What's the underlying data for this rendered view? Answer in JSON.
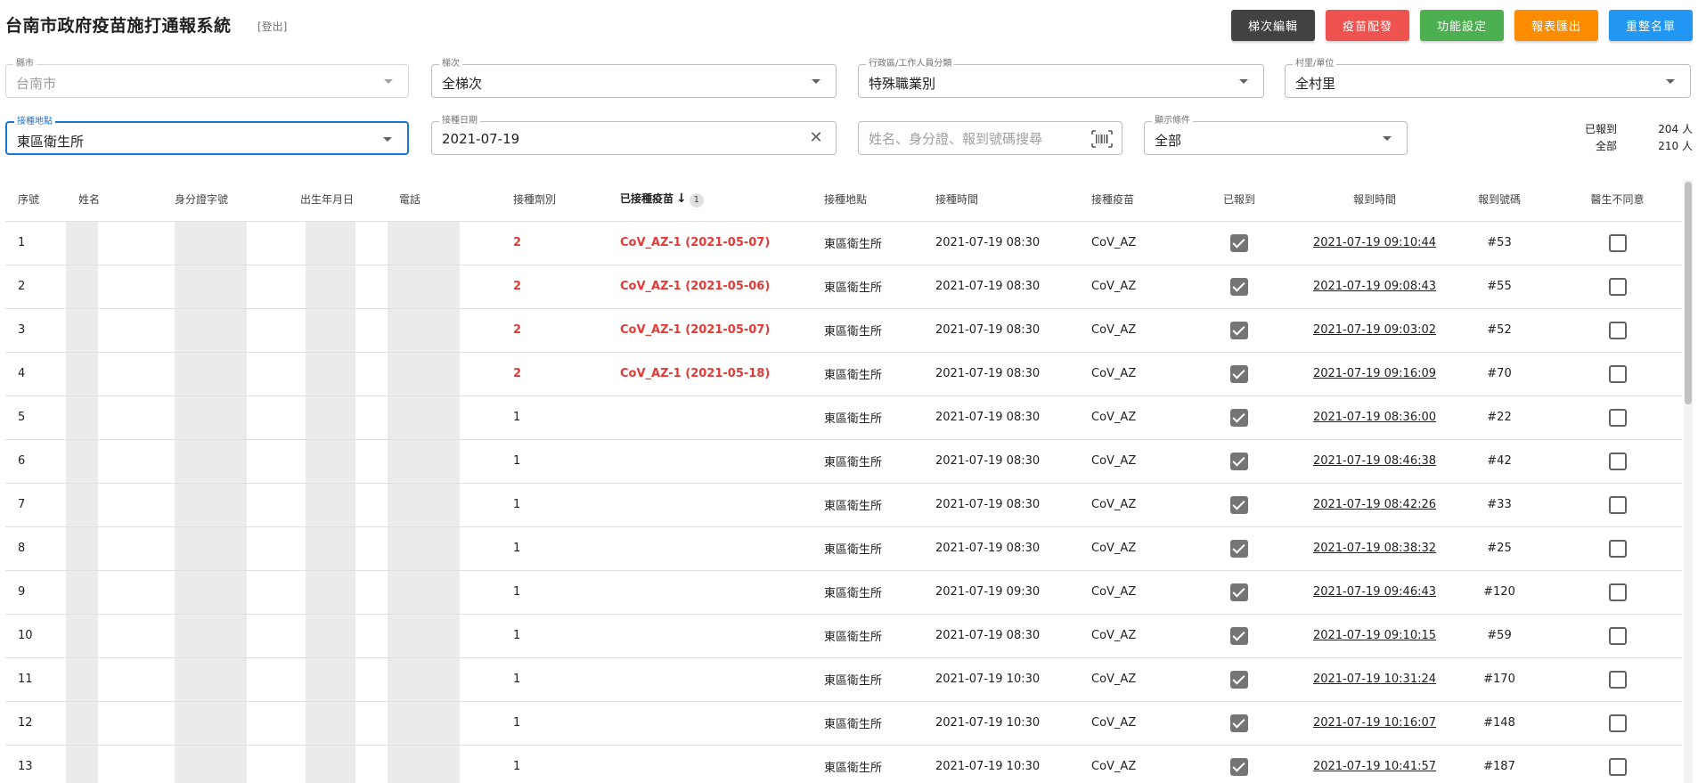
{
  "header": {
    "title": "台南市政府疫苗施打通報系統",
    "logout": "[登出]",
    "buttons": {
      "batch_edit": "梯次編輯",
      "vaccine_allocation": "疫苗配發",
      "settings": "功能設定",
      "export_report": "報表匯出",
      "reorder_list": "重整名單"
    }
  },
  "colors": {
    "dark": "#424242",
    "red": "#ef5350",
    "green": "#4caf50",
    "orange": "#fb8c00",
    "blue": "#2196f3",
    "focus": "#1976d2",
    "alert_text": "#e53935"
  },
  "filters": {
    "county": {
      "label": "縣市",
      "value": "台南市"
    },
    "batch": {
      "label": "梯次",
      "value": "全梯次"
    },
    "district": {
      "label": "行政區/工作人員分類",
      "value": "特殊職業別"
    },
    "village": {
      "label": "村里/單位",
      "value": "全村里"
    },
    "site": {
      "label": "接種地點",
      "value": "東區衛生所"
    },
    "date": {
      "label": "接種日期",
      "value": "2021-07-19"
    },
    "search": {
      "placeholder": "姓名、身分證、報到號碼搜尋"
    },
    "display": {
      "label": "顯示條件",
      "value": "全部"
    }
  },
  "counts": {
    "checked_in_label": "已報到",
    "checked_in_value": "204 人",
    "total_label": "全部",
    "total_value": "210 人"
  },
  "table": {
    "columns": {
      "seq": "序號",
      "name": "姓名",
      "id_number": "身分證字號",
      "birthdate": "出生年月日",
      "phone": "電話",
      "dose": "接種劑別",
      "prior_vaccine": "已接種疫苗",
      "sort_rank": "1",
      "site": "接種地點",
      "time": "接種時間",
      "vaccine": "接種疫苗",
      "checked_in": "已報到",
      "checkin_time": "報到時間",
      "checkin_no": "報到號碼",
      "doctor_refuse": "醫生不同意"
    },
    "rows": [
      {
        "seq": "1",
        "dose": "2",
        "prior": "CoV_AZ-1 (2021-05-07)",
        "site": "東區衛生所",
        "time": "2021-07-19 08:30",
        "vaccine": "CoV_AZ",
        "checked": true,
        "checkin_time": "2021-07-19 09:10:44",
        "no": "#53",
        "refuse": false
      },
      {
        "seq": "2",
        "dose": "2",
        "prior": "CoV_AZ-1 (2021-05-06)",
        "site": "東區衛生所",
        "time": "2021-07-19 08:30",
        "vaccine": "CoV_AZ",
        "checked": true,
        "checkin_time": "2021-07-19 09:08:43",
        "no": "#55",
        "refuse": false
      },
      {
        "seq": "3",
        "dose": "2",
        "prior": "CoV_AZ-1 (2021-05-07)",
        "site": "東區衛生所",
        "time": "2021-07-19 08:30",
        "vaccine": "CoV_AZ",
        "checked": true,
        "checkin_time": "2021-07-19 09:03:02",
        "no": "#52",
        "refuse": false
      },
      {
        "seq": "4",
        "dose": "2",
        "prior": "CoV_AZ-1 (2021-05-18)",
        "site": "東區衛生所",
        "time": "2021-07-19 08:30",
        "vaccine": "CoV_AZ",
        "checked": true,
        "checkin_time": "2021-07-19 09:16:09",
        "no": "#70",
        "refuse": false
      },
      {
        "seq": "5",
        "dose": "1",
        "prior": "",
        "site": "東區衛生所",
        "time": "2021-07-19 08:30",
        "vaccine": "CoV_AZ",
        "checked": true,
        "checkin_time": "2021-07-19 08:36:00",
        "no": "#22",
        "refuse": false
      },
      {
        "seq": "6",
        "dose": "1",
        "prior": "",
        "site": "東區衛生所",
        "time": "2021-07-19 08:30",
        "vaccine": "CoV_AZ",
        "checked": true,
        "checkin_time": "2021-07-19 08:46:38",
        "no": "#42",
        "refuse": false
      },
      {
        "seq": "7",
        "dose": "1",
        "prior": "",
        "site": "東區衛生所",
        "time": "2021-07-19 08:30",
        "vaccine": "CoV_AZ",
        "checked": true,
        "checkin_time": "2021-07-19 08:42:26",
        "no": "#33",
        "refuse": false
      },
      {
        "seq": "8",
        "dose": "1",
        "prior": "",
        "site": "東區衛生所",
        "time": "2021-07-19 08:30",
        "vaccine": "CoV_AZ",
        "checked": true,
        "checkin_time": "2021-07-19 08:38:32",
        "no": "#25",
        "refuse": false
      },
      {
        "seq": "9",
        "dose": "1",
        "prior": "",
        "site": "東區衛生所",
        "time": "2021-07-19 09:30",
        "vaccine": "CoV_AZ",
        "checked": true,
        "checkin_time": "2021-07-19 09:46:43",
        "no": "#120",
        "refuse": false
      },
      {
        "seq": "10",
        "dose": "1",
        "prior": "",
        "site": "東區衛生所",
        "time": "2021-07-19 08:30",
        "vaccine": "CoV_AZ",
        "checked": true,
        "checkin_time": "2021-07-19 09:10:15",
        "no": "#59",
        "refuse": false
      },
      {
        "seq": "11",
        "dose": "1",
        "prior": "",
        "site": "東區衛生所",
        "time": "2021-07-19 10:30",
        "vaccine": "CoV_AZ",
        "checked": true,
        "checkin_time": "2021-07-19 10:31:24",
        "no": "#170",
        "refuse": false
      },
      {
        "seq": "12",
        "dose": "1",
        "prior": "",
        "site": "東區衛生所",
        "time": "2021-07-19 10:30",
        "vaccine": "CoV_AZ",
        "checked": true,
        "checkin_time": "2021-07-19 10:16:07",
        "no": "#148",
        "refuse": false
      },
      {
        "seq": "13",
        "dose": "1",
        "prior": "",
        "site": "東區衛生所",
        "time": "2021-07-19 10:30",
        "vaccine": "CoV_AZ",
        "checked": true,
        "checkin_time": "2021-07-19 10:41:57",
        "no": "#187",
        "refuse": false
      }
    ]
  }
}
